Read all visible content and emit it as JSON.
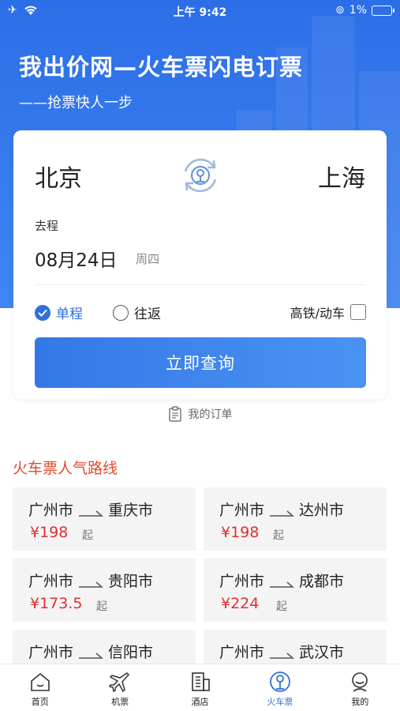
{
  "status_bar": {
    "time": "上午 9:42",
    "battery": "1%"
  },
  "hero": {
    "title": "我出价网—火车票闪电订票",
    "subtitle": "——抢票快人一步"
  },
  "search": {
    "from": "北京",
    "to": "上海",
    "departure_label": "去程",
    "date": "08月24日",
    "weekday": "周四",
    "one_way": "单程",
    "round_trip": "往返",
    "high_speed": "高铁/动车",
    "submit": "立即查询",
    "my_orders": "我的订单"
  },
  "popular": {
    "title": "火车票人气路线",
    "price_suffix": "起",
    "routes": [
      {
        "from": "广州市",
        "to": "重庆市",
        "price": "¥198"
      },
      {
        "from": "广州市",
        "to": "达州市",
        "price": "¥198"
      },
      {
        "from": "广州市",
        "to": "贵阳市",
        "price": "¥173.5"
      },
      {
        "from": "广州市",
        "to": "成都市",
        "price": "¥224"
      },
      {
        "from": "广州市",
        "to": "信阳市",
        "price": ""
      },
      {
        "from": "广州市",
        "to": "武汉市",
        "price": ""
      }
    ]
  },
  "tabs": [
    {
      "label": "首页",
      "icon": "home-icon"
    },
    {
      "label": "机票",
      "icon": "plane-icon"
    },
    {
      "label": "酒店",
      "icon": "hotel-icon"
    },
    {
      "label": "火车票",
      "icon": "train-icon",
      "active": true
    },
    {
      "label": "我的",
      "icon": "user-icon"
    }
  ],
  "colors": {
    "primary": "#2f6fde",
    "accent_red": "#e24a2b",
    "price_red": "#e02f2f"
  }
}
